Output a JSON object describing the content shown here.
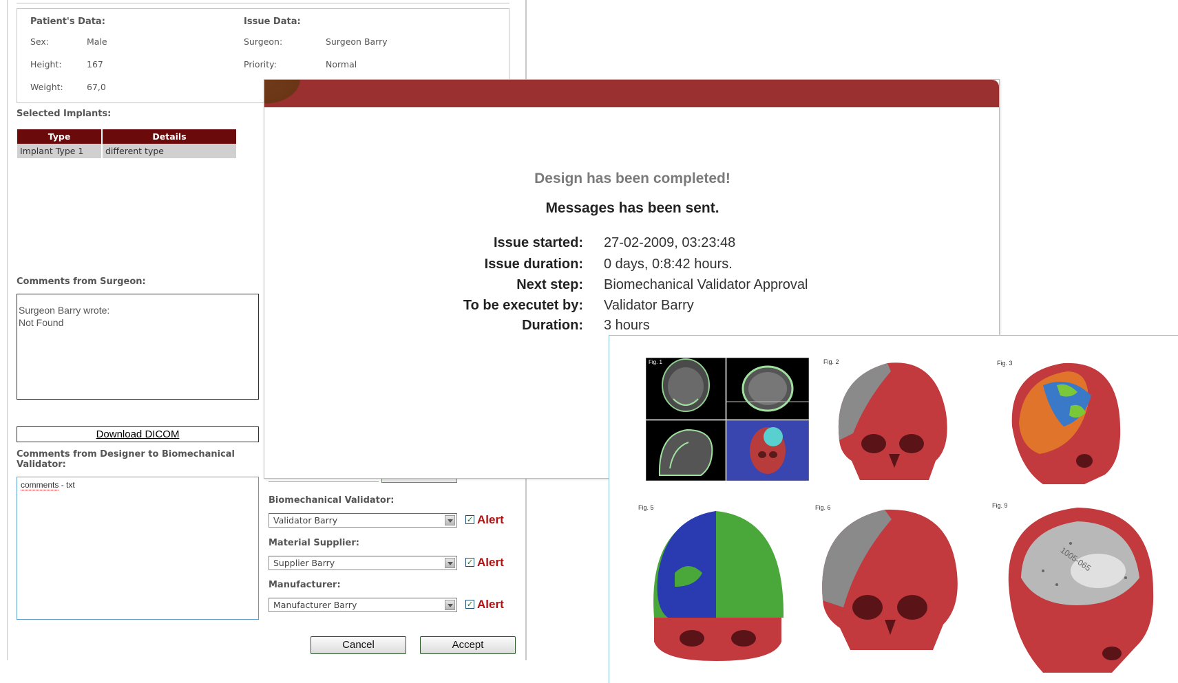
{
  "patient": {
    "title": "Patient's Data:",
    "fields": [
      {
        "label": "Sex:",
        "value": "Male"
      },
      {
        "label": "Height:",
        "value": "167"
      },
      {
        "label": "Weight:",
        "value": "67,0"
      }
    ]
  },
  "issue": {
    "title": "Issue Data:",
    "fields": [
      {
        "label": "Surgeon:",
        "value": "Surgeon Barry"
      },
      {
        "label": "Priority:",
        "value": "Normal"
      }
    ]
  },
  "implants": {
    "title": "Selected Implants:",
    "headers": [
      "Type",
      "Details"
    ],
    "rows": [
      [
        "Implant Type 1",
        "different type"
      ]
    ]
  },
  "surgeon_comments": {
    "title": "Comments from Surgeon:",
    "line1": "Surgeon Barry wrote:",
    "line2": "Not Found"
  },
  "download_label": "Download DICOM",
  "designer_comments": {
    "title": "Comments from Designer to Biomechanical Validator:",
    "text_a": "comments",
    "text_b": " - txt"
  },
  "assignments": [
    {
      "label": "Biomechanical Validator:",
      "value": "Validator Barry",
      "alert": "Alert",
      "checked": "✓"
    },
    {
      "label": "Material Supplier:",
      "value": "Supplier Barry",
      "alert": "Alert",
      "checked": "✓"
    },
    {
      "label": "Manufacturer:",
      "value": "Manufacturer Barry",
      "alert": "Alert",
      "checked": "✓"
    }
  ],
  "buttons": {
    "cancel": "Cancel",
    "accept": "Accept"
  },
  "modal": {
    "message1": "Design has been completed!",
    "message2": "Messages has been sent.",
    "details": [
      {
        "label": "Issue started:",
        "value": "27-02-2009, 03:23:48"
      },
      {
        "label": "Issue duration:",
        "value": "0 days, 0:8:42 hours."
      },
      {
        "label": "Next step:",
        "value": "Biomechanical Validator Approval"
      },
      {
        "label": "To be executet by:",
        "value": "Validator Barry"
      },
      {
        "label": "Duration:",
        "value": "3 hours"
      }
    ],
    "header_color": "#9a3030"
  },
  "figures": {
    "labels": [
      "Fig. 1",
      "Fig. 2",
      "Fig. 3",
      "Fig. 5",
      "Fig. 6",
      "Fig. 9"
    ],
    "engraving": "1005-065"
  }
}
